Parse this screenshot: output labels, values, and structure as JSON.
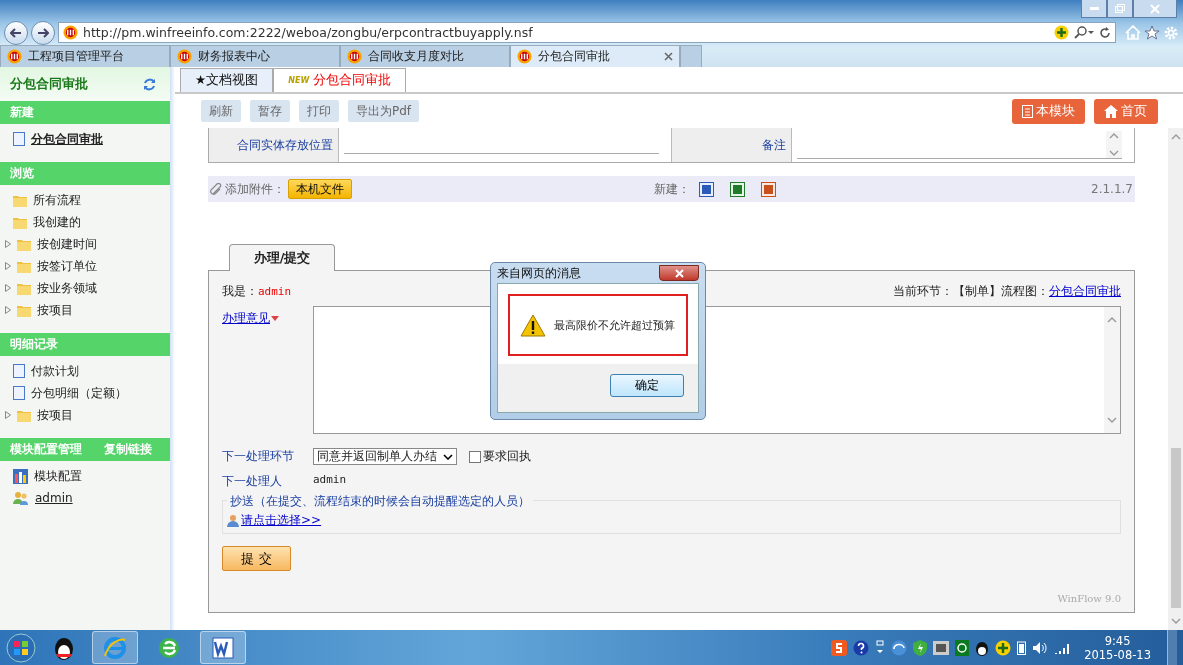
{
  "browser": {
    "url": "http://pm.winfreeinfo.com:2222/weboa/zongbu/erpcontractbuyapply.nsf",
    "tabs": [
      {
        "label": "工程项目管理平台",
        "selected": false
      },
      {
        "label": "财务报表中心",
        "selected": false
      },
      {
        "label": "合同收支月度对比",
        "selected": false
      },
      {
        "label": "分包合同审批",
        "selected": true
      }
    ]
  },
  "sidebar": {
    "title": "分包合同审批",
    "sections": [
      {
        "title": "新建",
        "items": [
          {
            "label": "分包合同审批",
            "kind": "doc",
            "expandable": false,
            "underlined": true
          }
        ]
      },
      {
        "title": "浏览",
        "items": [
          {
            "label": "所有流程",
            "kind": "folder",
            "expandable": false,
            "underlined": false
          },
          {
            "label": "我创建的",
            "kind": "folder",
            "expandable": false,
            "underlined": false
          },
          {
            "label": "按创建时间",
            "kind": "folder",
            "expandable": true,
            "underlined": false
          },
          {
            "label": "按签订单位",
            "kind": "folder",
            "expandable": true,
            "underlined": false
          },
          {
            "label": "按业务领域",
            "kind": "folder",
            "expandable": true,
            "underlined": false
          },
          {
            "label": "按项目",
            "kind": "folder",
            "expandable": true,
            "underlined": false
          }
        ]
      },
      {
        "title": "明细记录",
        "items": [
          {
            "label": "付款计划",
            "kind": "doc",
            "expandable": false,
            "underlined": false
          },
          {
            "label": "分包明细（定额）",
            "kind": "doc",
            "expandable": false,
            "underlined": false
          },
          {
            "label": "按项目",
            "kind": "folder",
            "expandable": true,
            "underlined": false
          }
        ]
      },
      {
        "title": "模块配置管理",
        "action": "复制链接",
        "items": [
          {
            "label": "模块配置",
            "kind": "config",
            "expandable": false,
            "underlined": false
          },
          {
            "label": "admin",
            "kind": "user",
            "expandable": false,
            "underlined": true
          }
        ]
      }
    ]
  },
  "view_tabs": [
    {
      "label": "★文档视图",
      "selected": false
    },
    {
      "label": "分包合同审批",
      "badge": "NEW",
      "selected": true
    }
  ],
  "toolbar": {
    "buttons": [
      "刷新",
      "暂存",
      "打印",
      "导出为Pdf"
    ],
    "nav": [
      {
        "label": "本模块",
        "kind": "module"
      },
      {
        "label": "首页",
        "kind": "home"
      }
    ]
  },
  "form": {
    "storage_label": "合同实体存放位置",
    "remark_label": "备注"
  },
  "attachments": {
    "label": "添加附件：",
    "button": "本机文件",
    "new_label": "新建：",
    "version": "2.1.1.7"
  },
  "process": {
    "tab": "办理/提交",
    "me_label": "我是：",
    "me_value": "admin",
    "current": "当前环节：【制单】流程图：",
    "flow_link": "分包合同审批",
    "opinion_link": "办理意见",
    "next_step_label": "下一处理环节",
    "next_step_value": "同意并返回制单人办结",
    "receipt": {
      "label": "要求回执",
      "checked": false
    },
    "next_person_label": "下一处理人",
    "next_person_value": "admin",
    "cc_legend": "抄送（在提交、流程结束的时候会自动提醒选定的人员）",
    "cc_link": "请点击选择>>",
    "submit": "提 交",
    "footer": "WinFlow 9.0"
  },
  "dialog": {
    "title": "来自网页的消息",
    "message": "最高限价不允许超过预算",
    "ok": "确定"
  },
  "taskbar": {
    "time": "9:45",
    "date": "2015-08-13"
  }
}
